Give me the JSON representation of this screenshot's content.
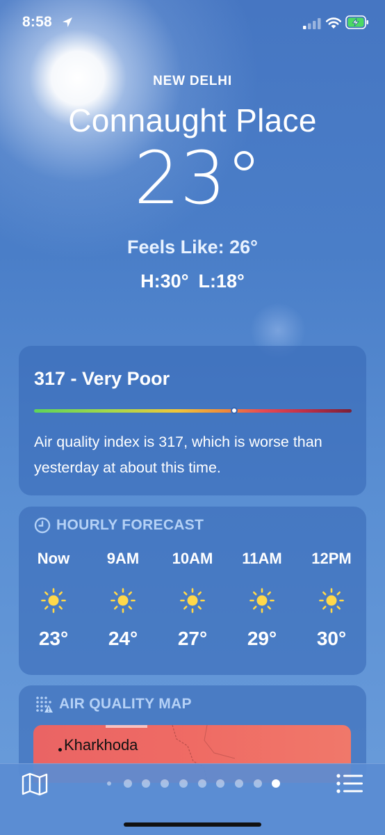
{
  "status_bar": {
    "time": "8:58",
    "icons": [
      "location-arrow-icon",
      "cellular-signal-icon",
      "wifi-icon",
      "battery-charging-icon"
    ],
    "battery_color": "#4cd964"
  },
  "header": {
    "city": "NEW DELHI",
    "place": "Connaught Place",
    "temperature": "23°",
    "feels_like": "Feels Like: 26°",
    "high": "H:30°",
    "low": "L:18°"
  },
  "air_quality": {
    "title": "317 - Very Poor",
    "index_value": 317,
    "scale_position": 0.63,
    "description": "Air quality index is 317, which is worse than yesterday at about this time."
  },
  "hourly_forecast": {
    "heading": "HOURLY FORECAST",
    "icon": "clock-icon",
    "hours": [
      {
        "label": "Now",
        "icon": "sun-icon",
        "temp": "23°"
      },
      {
        "label": "9AM",
        "icon": "sun-icon",
        "temp": "24°"
      },
      {
        "label": "10AM",
        "icon": "sun-icon",
        "temp": "27°"
      },
      {
        "label": "11AM",
        "icon": "sun-icon",
        "temp": "29°"
      },
      {
        "label": "12PM",
        "icon": "sun-icon",
        "temp": "30°"
      }
    ]
  },
  "air_quality_map": {
    "heading": "AIR QUALITY MAP",
    "icon": "air-quality-dots-icon",
    "map_label": "Kharkhoda",
    "map_color": "#ea6464"
  },
  "bottom_bar": {
    "left_icon": "map-icon",
    "right_icon": "list-icon",
    "page_count": 10,
    "active_page": 10
  },
  "colors": {
    "sky": "#4a7ec8",
    "card": "#3466b4",
    "sun": "#ffd84a"
  }
}
